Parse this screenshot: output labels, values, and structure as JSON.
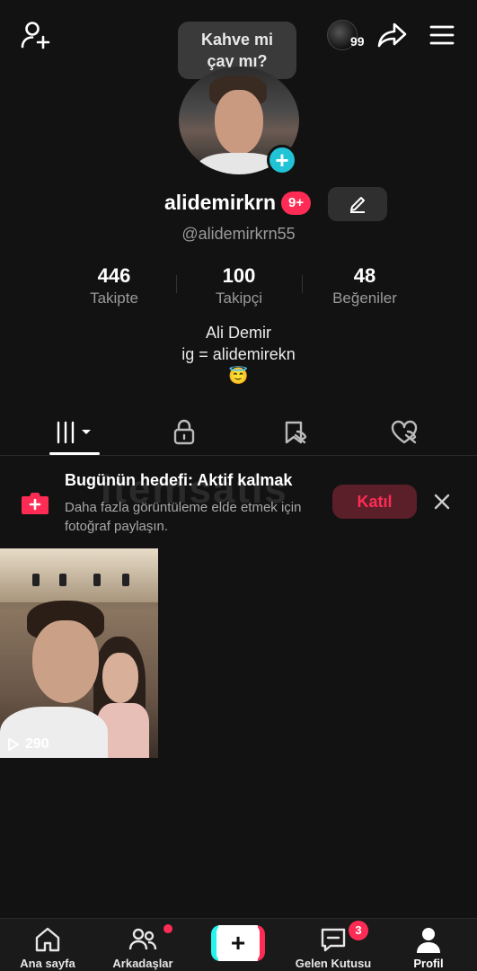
{
  "header": {
    "tooltip_line1": "Kahve mi",
    "tooltip_line2": "çay mı?",
    "story_count": "99"
  },
  "profile": {
    "username": "alidemirkrn",
    "notification_badge": "9+",
    "handle": "@alidemirkrn55",
    "stats": [
      {
        "value": "446",
        "label": "Takipte"
      },
      {
        "value": "100",
        "label": "Takipçi"
      },
      {
        "value": "48",
        "label": "Beğeniler"
      }
    ],
    "bio_line1": "Ali Demir",
    "bio_line2": "ig = alidemirekn",
    "bio_line3": "😇"
  },
  "goal_banner": {
    "title": "Bugünün hedefi: Aktif kalmak",
    "subtitle": "Daha fazla görüntüleme elde etmek için fotoğraf paylaşın.",
    "join_label": "Katıl",
    "watermark": "itemsatis"
  },
  "videos": [
    {
      "views": "290"
    }
  ],
  "bottom_nav": {
    "home": "Ana sayfa",
    "friends": "Arkadaşlar",
    "inbox": "Gelen Kutusu",
    "inbox_badge": "3",
    "profile": "Profil"
  },
  "colors": {
    "background": "#121212",
    "accent": "#fe2c55",
    "teal": "#20c4d6"
  }
}
